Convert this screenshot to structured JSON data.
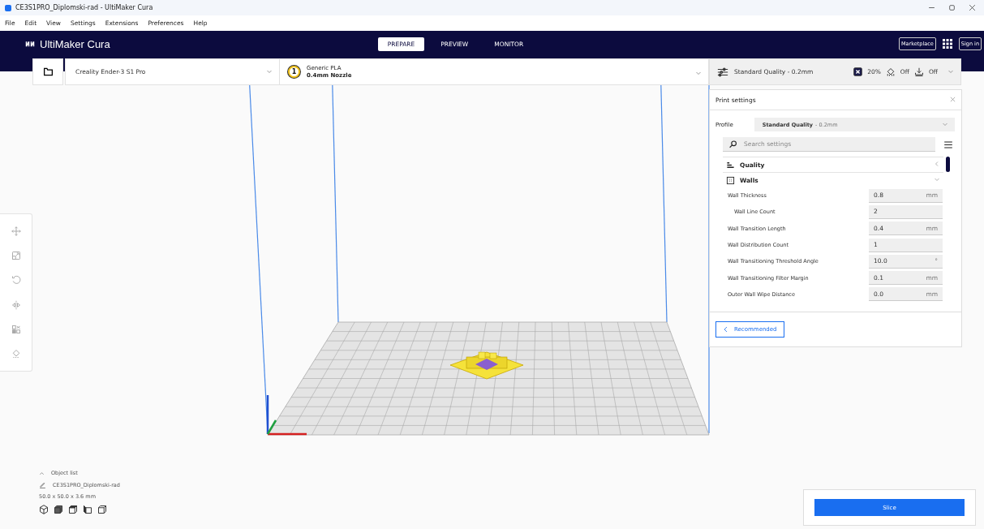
{
  "window": {
    "title": "CE3S1PRO_Diplomski-rad - UltiMaker Cura"
  },
  "menu": [
    "File",
    "Edit",
    "View",
    "Settings",
    "Extensions",
    "Preferences",
    "Help"
  ],
  "header": {
    "logo": "UltiMaker Cura",
    "stages": [
      {
        "label": "PREPARE",
        "selected": true
      },
      {
        "label": "PREVIEW",
        "selected": false
      },
      {
        "label": "MONITOR",
        "selected": false
      }
    ],
    "marketplace": "Marketplace",
    "sign_in": "Sign in"
  },
  "printer": {
    "name": "Creality Ender-3 S1 Pro"
  },
  "extruder": {
    "number": "1",
    "material": "Generic PLA",
    "nozzle": "0.4mm Nozzle"
  },
  "print_summary": {
    "profile": "Standard Quality - 0.2mm",
    "infill": "20%",
    "support": "Off",
    "adhesion": "Off"
  },
  "print_settings": {
    "title": "Print settings",
    "profile_label": "Profile",
    "profile_name": "Standard Quality",
    "profile_layer": "- 0.2mm",
    "search_placeholder": "Search settings",
    "categories": [
      {
        "kind": "quality",
        "label": "Quality",
        "expanded": false
      },
      {
        "kind": "walls",
        "label": "Walls",
        "expanded": true
      }
    ],
    "settings": [
      {
        "label": "Wall Thickness",
        "value": "0.8",
        "unit": "mm",
        "children": [
          {
            "label": "Wall Line Count",
            "value": "2"
          }
        ]
      },
      {
        "label": "Wall Transition Length",
        "value": "0.4",
        "unit": "mm"
      },
      {
        "label": "Wall Distribution Count",
        "value": "1"
      },
      {
        "label": "Wall Transitioning Threshold Angle",
        "value": "10.0",
        "unit": "°"
      },
      {
        "label": "Wall Transitioning Filter Margin",
        "value": "0.1",
        "unit": "mm"
      },
      {
        "label": "Outer Wall Wipe Distance",
        "value": "0.0",
        "unit": "mm"
      }
    ],
    "recommended_button": "Recommended"
  },
  "object_list": {
    "label": "Object list",
    "object_name": "CE3S1PRO_Diplomski-rad",
    "dimensions": "50.0 x 50.0 x 3.6 mm"
  },
  "slice_button": "Slice"
}
